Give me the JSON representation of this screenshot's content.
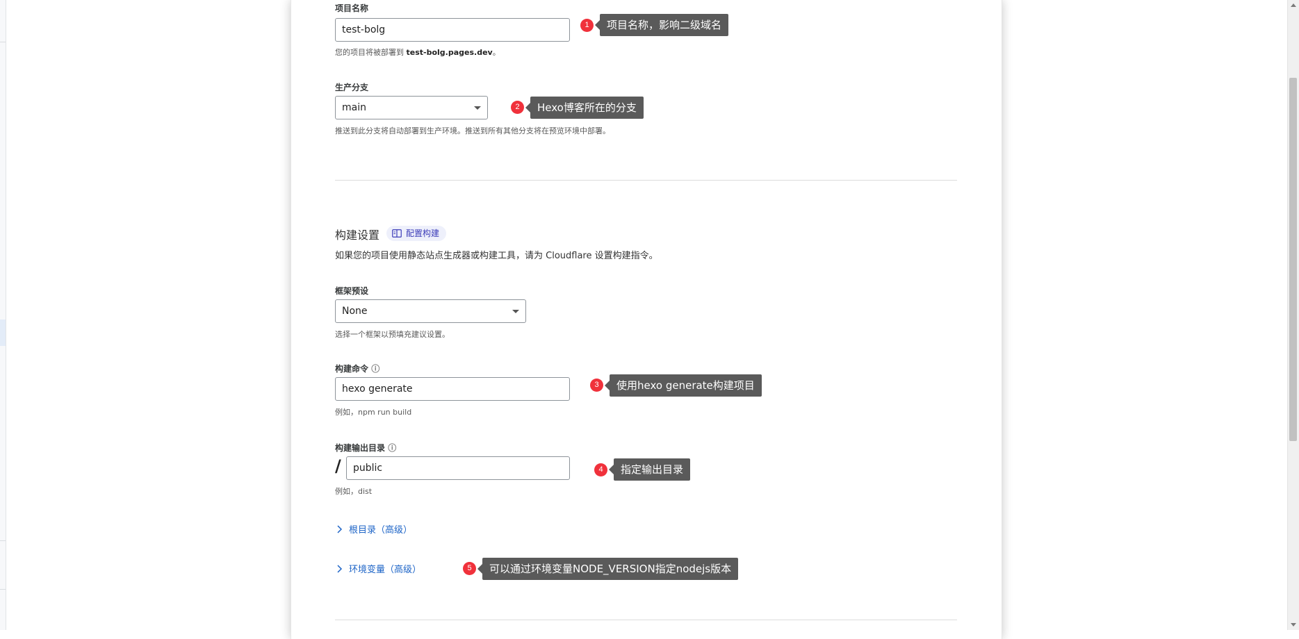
{
  "form": {
    "project_name": {
      "label": "项目名称",
      "value": "test-bolg",
      "help_prefix": "您的项目将被部署到 ",
      "help_domain": "test-bolg.pages.dev",
      "help_suffix": "。"
    },
    "production_branch": {
      "label": "生产分支",
      "value": "main",
      "help": "推送到此分支将自动部署到生产环境。推送到所有其他分支将在预览环境中部署。"
    },
    "build_settings": {
      "title": "构建设置",
      "badge": "配置构建",
      "description": "如果您的项目使用静态站点生成器或构建工具，请为 Cloudflare 设置构建指令。"
    },
    "framework_preset": {
      "label": "框架预设",
      "value": "None",
      "help": "选择一个框架以预填充建议设置。"
    },
    "build_command": {
      "label": "构建命令",
      "value": "hexo generate",
      "help": "例如，npm run build"
    },
    "build_output": {
      "label": "构建输出目录",
      "prefix": "/",
      "value": "public",
      "help": "例如，dist"
    },
    "root_dir_link": "根目录（高级）",
    "env_vars_link": "环境变量（高级）"
  },
  "annotations": [
    {
      "num": "1",
      "text": "项目名称，影响二级域名"
    },
    {
      "num": "2",
      "text": "Hexo博客所在的分支"
    },
    {
      "num": "3",
      "text": "使用hexo generate构建项目"
    },
    {
      "num": "4",
      "text": "指定输出目录"
    },
    {
      "num": "5",
      "text": "可以通过环境变量NODE_VERSION指定nodejs版本"
    }
  ],
  "icons": {
    "info": "info-icon",
    "book": "book-icon",
    "chevron": "chevron-right-icon",
    "caret": "chevron-down-icon"
  },
  "colors": {
    "annotation_badge": "#f0313b",
    "annotation_tip": "#5a5a5a",
    "link": "#1d64c7",
    "badge_bg": "#eef0fb"
  }
}
